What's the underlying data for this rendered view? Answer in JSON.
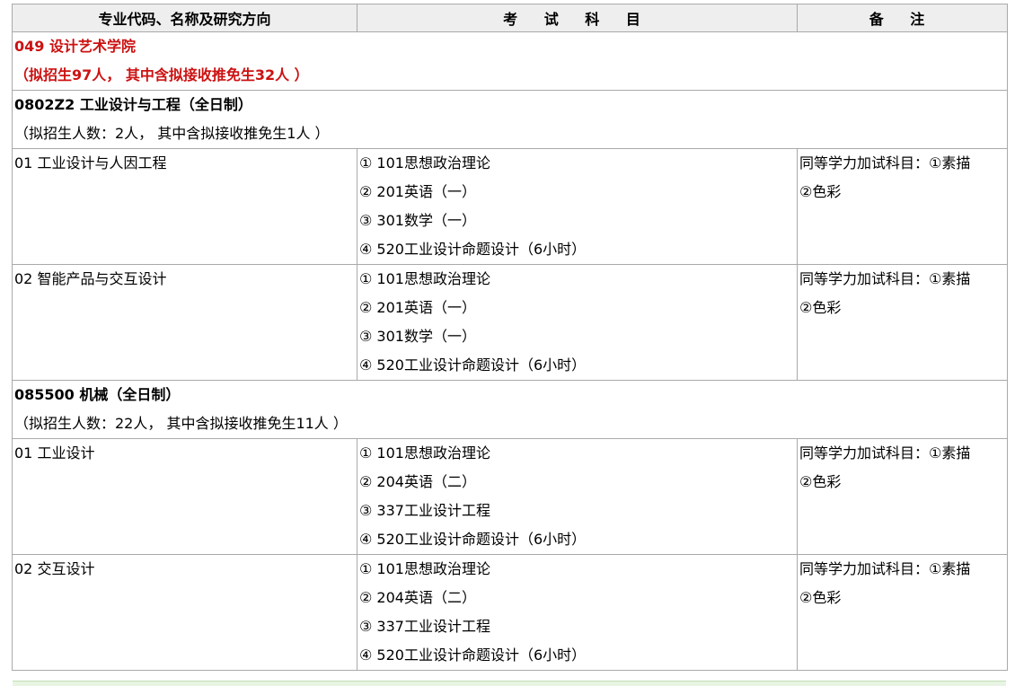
{
  "header": {
    "col1": "专业代码、名称及研究方向",
    "col2": "考 试 科 目",
    "col3": "备 注"
  },
  "school": {
    "name": "049 设计艺术学院",
    "quota": "（拟招生97人， 其中含拟接收推免生32人 ）"
  },
  "majors": [
    {
      "title": "0802Z2 工业设计与工程（全日制）",
      "quota": "（拟招生人数：2人， 其中含拟接收推免生1人 ）",
      "directions": [
        {
          "name": "01 工业设计与人因工程",
          "subjects": [
            "① 101思想政治理论",
            "② 201英语（一）",
            "③ 301数学（一）",
            "④ 520工业设计命题设计（6小时）"
          ],
          "notes": [
            "同等学力加试科目：①素描",
            "②色彩"
          ]
        },
        {
          "name": "02 智能产品与交互设计",
          "subjects": [
            "① 101思想政治理论",
            "② 201英语（一）",
            "③ 301数学（一）",
            "④ 520工业设计命题设计（6小时）"
          ],
          "notes": [
            "同等学力加试科目：①素描",
            "②色彩"
          ]
        }
      ]
    },
    {
      "title": "085500 机械（全日制）",
      "quota": "（拟招生人数：22人， 其中含拟接收推免生11人 ）",
      "directions": [
        {
          "name": "01 工业设计",
          "subjects": [
            "① 101思想政治理论",
            "② 204英语（二）",
            "③ 337工业设计工程",
            "④ 520工业设计命题设计（6小时）"
          ],
          "notes": [
            "同等学力加试科目：①素描",
            "②色彩"
          ]
        },
        {
          "name": "02 交互设计",
          "subjects": [
            "① 101思想政治理论",
            "② 204英语（二）",
            "③ 337工业设计工程",
            "④ 520工业设计命题设计（6小时）"
          ],
          "notes": [
            "同等学力加试科目：①素描",
            "②色彩"
          ]
        }
      ]
    }
  ]
}
